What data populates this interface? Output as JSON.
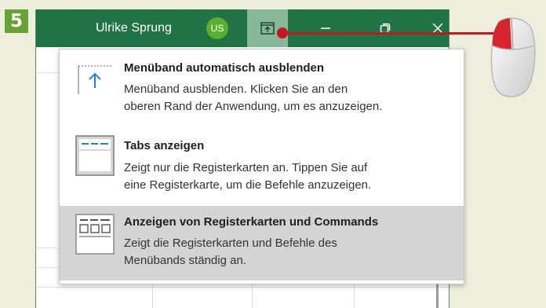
{
  "step": "5",
  "titlebar": {
    "user_name": "Ulrike Sprung",
    "user_initials": "US",
    "accent": "#217346"
  },
  "menu": {
    "items": [
      {
        "title": "Menüband automatisch ausblenden",
        "description_line1": "Menüband ausblenden. Klicken Sie an den",
        "description_line2": "oberen Rand der Anwendung, um es anzuzeigen.",
        "icon": "autohide-ribbon-icon"
      },
      {
        "title": "Tabs anzeigen",
        "description_line1": "Zeigt nur die Registerkarten an. Tippen Sie auf",
        "description_line2": "eine Registerkarte, um die Befehle anzuzeigen.",
        "icon": "show-tabs-icon"
      },
      {
        "title": "Anzeigen von Registerkarten und Commands",
        "description_line1": "Zeigt die Registerkarten und Befehle des",
        "description_line2": "Menübands ständig an.",
        "icon": "show-tabs-commands-icon",
        "selected": true
      }
    ]
  },
  "colors": {
    "selected_bg": "#d4d4d4",
    "badge": "#67a232",
    "pointer": "#c4161c"
  }
}
